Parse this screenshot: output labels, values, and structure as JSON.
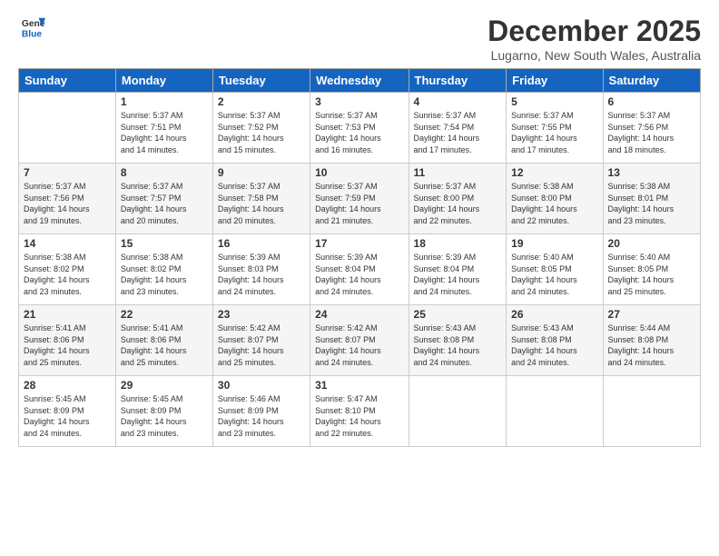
{
  "logo": {
    "line1": "General",
    "line2": "Blue"
  },
  "header": {
    "title": "December 2025",
    "location": "Lugarno, New South Wales, Australia"
  },
  "weekdays": [
    "Sunday",
    "Monday",
    "Tuesday",
    "Wednesday",
    "Thursday",
    "Friday",
    "Saturday"
  ],
  "weeks": [
    [
      {
        "day": "",
        "info": ""
      },
      {
        "day": "1",
        "info": "Sunrise: 5:37 AM\nSunset: 7:51 PM\nDaylight: 14 hours\nand 14 minutes."
      },
      {
        "day": "2",
        "info": "Sunrise: 5:37 AM\nSunset: 7:52 PM\nDaylight: 14 hours\nand 15 minutes."
      },
      {
        "day": "3",
        "info": "Sunrise: 5:37 AM\nSunset: 7:53 PM\nDaylight: 14 hours\nand 16 minutes."
      },
      {
        "day": "4",
        "info": "Sunrise: 5:37 AM\nSunset: 7:54 PM\nDaylight: 14 hours\nand 17 minutes."
      },
      {
        "day": "5",
        "info": "Sunrise: 5:37 AM\nSunset: 7:55 PM\nDaylight: 14 hours\nand 17 minutes."
      },
      {
        "day": "6",
        "info": "Sunrise: 5:37 AM\nSunset: 7:56 PM\nDaylight: 14 hours\nand 18 minutes."
      }
    ],
    [
      {
        "day": "7",
        "info": "Sunrise: 5:37 AM\nSunset: 7:56 PM\nDaylight: 14 hours\nand 19 minutes."
      },
      {
        "day": "8",
        "info": "Sunrise: 5:37 AM\nSunset: 7:57 PM\nDaylight: 14 hours\nand 20 minutes."
      },
      {
        "day": "9",
        "info": "Sunrise: 5:37 AM\nSunset: 7:58 PM\nDaylight: 14 hours\nand 20 minutes."
      },
      {
        "day": "10",
        "info": "Sunrise: 5:37 AM\nSunset: 7:59 PM\nDaylight: 14 hours\nand 21 minutes."
      },
      {
        "day": "11",
        "info": "Sunrise: 5:37 AM\nSunset: 8:00 PM\nDaylight: 14 hours\nand 22 minutes."
      },
      {
        "day": "12",
        "info": "Sunrise: 5:38 AM\nSunset: 8:00 PM\nDaylight: 14 hours\nand 22 minutes."
      },
      {
        "day": "13",
        "info": "Sunrise: 5:38 AM\nSunset: 8:01 PM\nDaylight: 14 hours\nand 23 minutes."
      }
    ],
    [
      {
        "day": "14",
        "info": "Sunrise: 5:38 AM\nSunset: 8:02 PM\nDaylight: 14 hours\nand 23 minutes."
      },
      {
        "day": "15",
        "info": "Sunrise: 5:38 AM\nSunset: 8:02 PM\nDaylight: 14 hours\nand 23 minutes."
      },
      {
        "day": "16",
        "info": "Sunrise: 5:39 AM\nSunset: 8:03 PM\nDaylight: 14 hours\nand 24 minutes."
      },
      {
        "day": "17",
        "info": "Sunrise: 5:39 AM\nSunset: 8:04 PM\nDaylight: 14 hours\nand 24 minutes."
      },
      {
        "day": "18",
        "info": "Sunrise: 5:39 AM\nSunset: 8:04 PM\nDaylight: 14 hours\nand 24 minutes."
      },
      {
        "day": "19",
        "info": "Sunrise: 5:40 AM\nSunset: 8:05 PM\nDaylight: 14 hours\nand 24 minutes."
      },
      {
        "day": "20",
        "info": "Sunrise: 5:40 AM\nSunset: 8:05 PM\nDaylight: 14 hours\nand 25 minutes."
      }
    ],
    [
      {
        "day": "21",
        "info": "Sunrise: 5:41 AM\nSunset: 8:06 PM\nDaylight: 14 hours\nand 25 minutes."
      },
      {
        "day": "22",
        "info": "Sunrise: 5:41 AM\nSunset: 8:06 PM\nDaylight: 14 hours\nand 25 minutes."
      },
      {
        "day": "23",
        "info": "Sunrise: 5:42 AM\nSunset: 8:07 PM\nDaylight: 14 hours\nand 25 minutes."
      },
      {
        "day": "24",
        "info": "Sunrise: 5:42 AM\nSunset: 8:07 PM\nDaylight: 14 hours\nand 24 minutes."
      },
      {
        "day": "25",
        "info": "Sunrise: 5:43 AM\nSunset: 8:08 PM\nDaylight: 14 hours\nand 24 minutes."
      },
      {
        "day": "26",
        "info": "Sunrise: 5:43 AM\nSunset: 8:08 PM\nDaylight: 14 hours\nand 24 minutes."
      },
      {
        "day": "27",
        "info": "Sunrise: 5:44 AM\nSunset: 8:08 PM\nDaylight: 14 hours\nand 24 minutes."
      }
    ],
    [
      {
        "day": "28",
        "info": "Sunrise: 5:45 AM\nSunset: 8:09 PM\nDaylight: 14 hours\nand 24 minutes."
      },
      {
        "day": "29",
        "info": "Sunrise: 5:45 AM\nSunset: 8:09 PM\nDaylight: 14 hours\nand 23 minutes."
      },
      {
        "day": "30",
        "info": "Sunrise: 5:46 AM\nSunset: 8:09 PM\nDaylight: 14 hours\nand 23 minutes."
      },
      {
        "day": "31",
        "info": "Sunrise: 5:47 AM\nSunset: 8:10 PM\nDaylight: 14 hours\nand 22 minutes."
      },
      {
        "day": "",
        "info": ""
      },
      {
        "day": "",
        "info": ""
      },
      {
        "day": "",
        "info": ""
      }
    ]
  ]
}
